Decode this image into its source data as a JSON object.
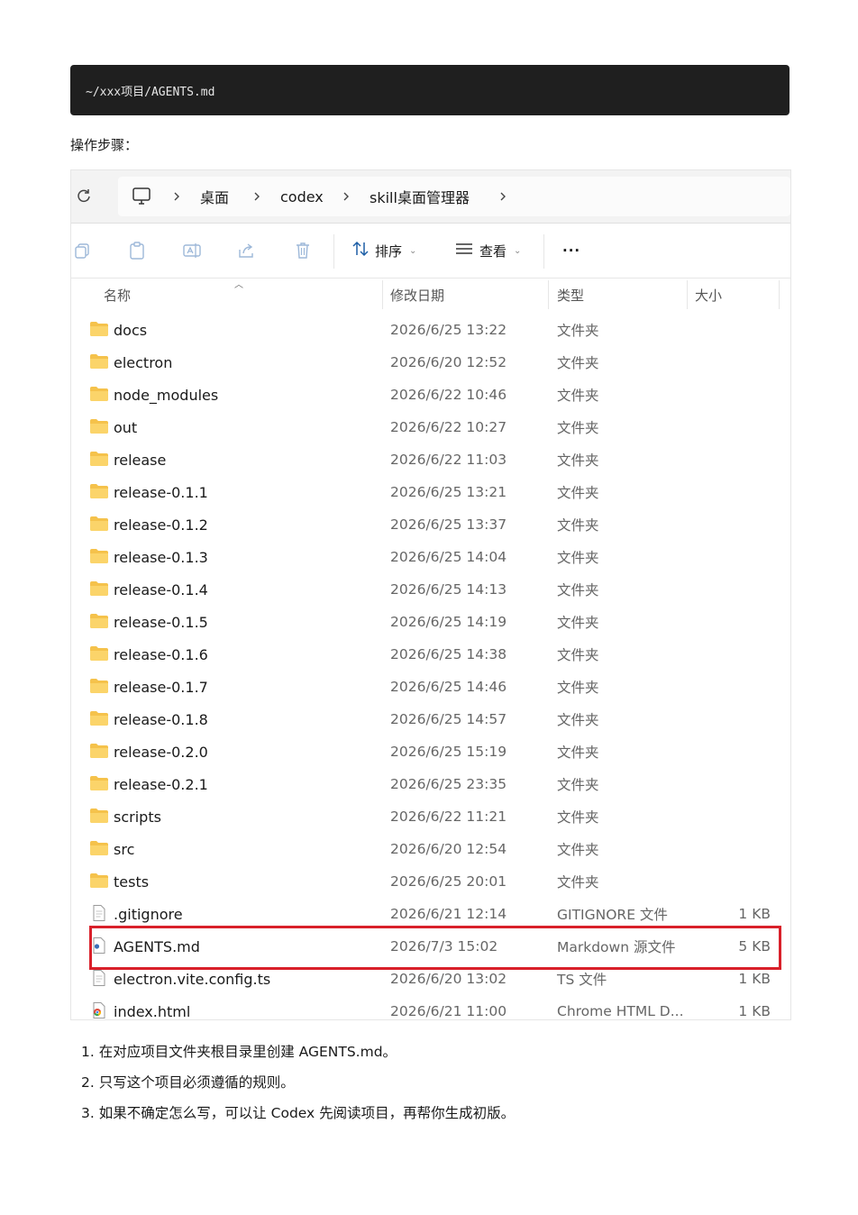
{
  "code_block": {
    "text": "~/xxx项目/AGENTS.md"
  },
  "steps_heading": "操作步骤：",
  "explorer": {
    "breadcrumbs": [
      "桌面",
      "codex",
      "skill桌面管理器"
    ],
    "toolbar": {
      "icons": [
        "copy-icon",
        "paste-icon",
        "rename-icon",
        "share-icon",
        "delete-icon"
      ],
      "sort_label": "排序",
      "view_label": "查看",
      "more_label": "···"
    },
    "columns": {
      "name": "名称",
      "date": "修改日期",
      "type": "类型",
      "size": "大小"
    },
    "rows": [
      {
        "name": "docs",
        "date": "2026/6/25 13:22",
        "type": "文件夹",
        "size": "",
        "icon": "folder-icon"
      },
      {
        "name": "electron",
        "date": "2026/6/20 12:52",
        "type": "文件夹",
        "size": "",
        "icon": "folder-icon"
      },
      {
        "name": "node_modules",
        "date": "2026/6/22 10:46",
        "type": "文件夹",
        "size": "",
        "icon": "folder-icon"
      },
      {
        "name": "out",
        "date": "2026/6/22 10:27",
        "type": "文件夹",
        "size": "",
        "icon": "folder-icon"
      },
      {
        "name": "release",
        "date": "2026/6/22 11:03",
        "type": "文件夹",
        "size": "",
        "icon": "folder-icon"
      },
      {
        "name": "release-0.1.1",
        "date": "2026/6/25 13:21",
        "type": "文件夹",
        "size": "",
        "icon": "folder-icon"
      },
      {
        "name": "release-0.1.2",
        "date": "2026/6/25 13:37",
        "type": "文件夹",
        "size": "",
        "icon": "folder-icon"
      },
      {
        "name": "release-0.1.3",
        "date": "2026/6/25 14:04",
        "type": "文件夹",
        "size": "",
        "icon": "folder-icon"
      },
      {
        "name": "release-0.1.4",
        "date": "2026/6/25 14:13",
        "type": "文件夹",
        "size": "",
        "icon": "folder-icon"
      },
      {
        "name": "release-0.1.5",
        "date": "2026/6/25 14:19",
        "type": "文件夹",
        "size": "",
        "icon": "folder-icon"
      },
      {
        "name": "release-0.1.6",
        "date": "2026/6/25 14:38",
        "type": "文件夹",
        "size": "",
        "icon": "folder-icon"
      },
      {
        "name": "release-0.1.7",
        "date": "2026/6/25 14:46",
        "type": "文件夹",
        "size": "",
        "icon": "folder-icon"
      },
      {
        "name": "release-0.1.8",
        "date": "2026/6/25 14:57",
        "type": "文件夹",
        "size": "",
        "icon": "folder-icon"
      },
      {
        "name": "release-0.2.0",
        "date": "2026/6/25 15:19",
        "type": "文件夹",
        "size": "",
        "icon": "folder-icon"
      },
      {
        "name": "release-0.2.1",
        "date": "2026/6/25 23:35",
        "type": "文件夹",
        "size": "",
        "icon": "folder-icon"
      },
      {
        "name": "scripts",
        "date": "2026/6/22 11:21",
        "type": "文件夹",
        "size": "",
        "icon": "folder-icon"
      },
      {
        "name": "src",
        "date": "2026/6/20 12:54",
        "type": "文件夹",
        "size": "",
        "icon": "folder-icon"
      },
      {
        "name": "tests",
        "date": "2026/6/25 20:01",
        "type": "文件夹",
        "size": "",
        "icon": "folder-icon"
      },
      {
        "name": ".gitignore",
        "date": "2026/6/21 12:14",
        "type": "GITIGNORE 文件",
        "size": "1 KB",
        "icon": "file-icon"
      },
      {
        "name": "AGENTS.md",
        "date": "2026/7/3 15:02",
        "type": "Markdown 源文件",
        "size": "5 KB",
        "icon": "markdown-file-icon",
        "highlighted": true
      },
      {
        "name": "electron.vite.config.ts",
        "date": "2026/6/20 13:02",
        "type": "TS 文件",
        "size": "1 KB",
        "icon": "file-icon"
      },
      {
        "name": "index.html",
        "date": "2026/6/21 11:00",
        "type": "Chrome HTML D...",
        "size": "1 KB",
        "icon": "chrome-html-icon"
      }
    ]
  },
  "steps": [
    "1. 在对应项目文件夹根目录里创建 AGENTS.md。",
    "2. 只写这个项目必须遵循的规则。",
    "3. 如果不确定怎么写，可以让 Codex 先阅读项目，再帮你生成初版。"
  ],
  "colors": {
    "highlight_border": "#d9202a",
    "folder": "#f5c24b",
    "code_bg": "#1f1f1f"
  }
}
